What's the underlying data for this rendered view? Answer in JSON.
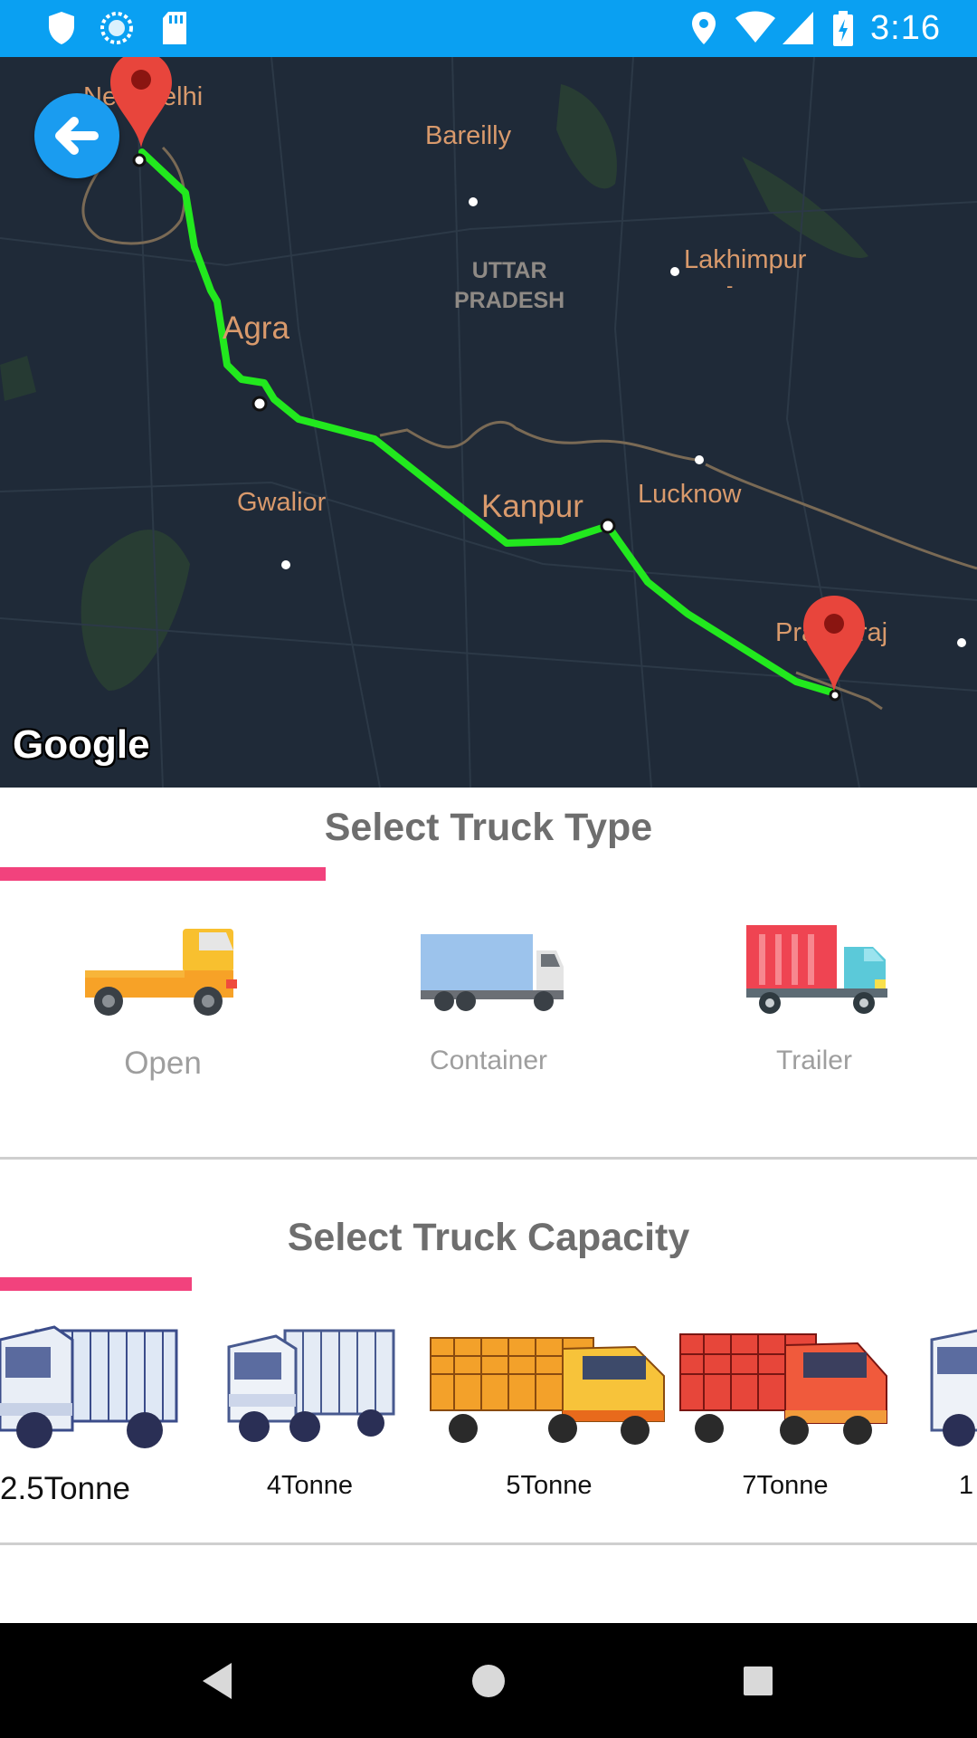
{
  "status_bar": {
    "time": "3:16",
    "left_icons": [
      "shield-icon",
      "sync-icon",
      "sd-card-icon"
    ],
    "right_icons": [
      "location-icon",
      "wifi-icon",
      "signal-icon",
      "battery-charging-icon"
    ],
    "background": "#0aa0f2"
  },
  "map": {
    "labels": {
      "new_delhi": "New Delhi",
      "bareilly": "Bareilly",
      "lakhimpur": "Lakhimpur",
      "lakhimpur_sub": "-",
      "state": "UTTAR\nPRADESH",
      "agra": "Agra",
      "gwalior": "Gwalior",
      "kanpur": "Kanpur",
      "lucknow": "Lucknow",
      "prayagraj": "Prayagraj"
    },
    "google_logo": "Google",
    "route_color": "#22e81e",
    "pin_color": "#e8453c"
  },
  "truck_type": {
    "title": "Select Truck Type",
    "items": [
      {
        "label": "Open",
        "icon": "open-truck-icon"
      },
      {
        "label": "Container",
        "icon": "container-truck-icon"
      },
      {
        "label": "Trailer",
        "icon": "trailer-truck-icon"
      }
    ],
    "accent": "#f2427d"
  },
  "truck_capacity": {
    "title": "Select Truck Capacity",
    "items": [
      {
        "label": "2.5Tonne"
      },
      {
        "label": "4Tonne"
      },
      {
        "label": "5Tonne"
      },
      {
        "label": "7Tonne"
      },
      {
        "label": "1"
      }
    ]
  },
  "nav_bar": {
    "buttons": [
      "back-nav-icon",
      "home-nav-icon",
      "recents-nav-icon"
    ]
  }
}
